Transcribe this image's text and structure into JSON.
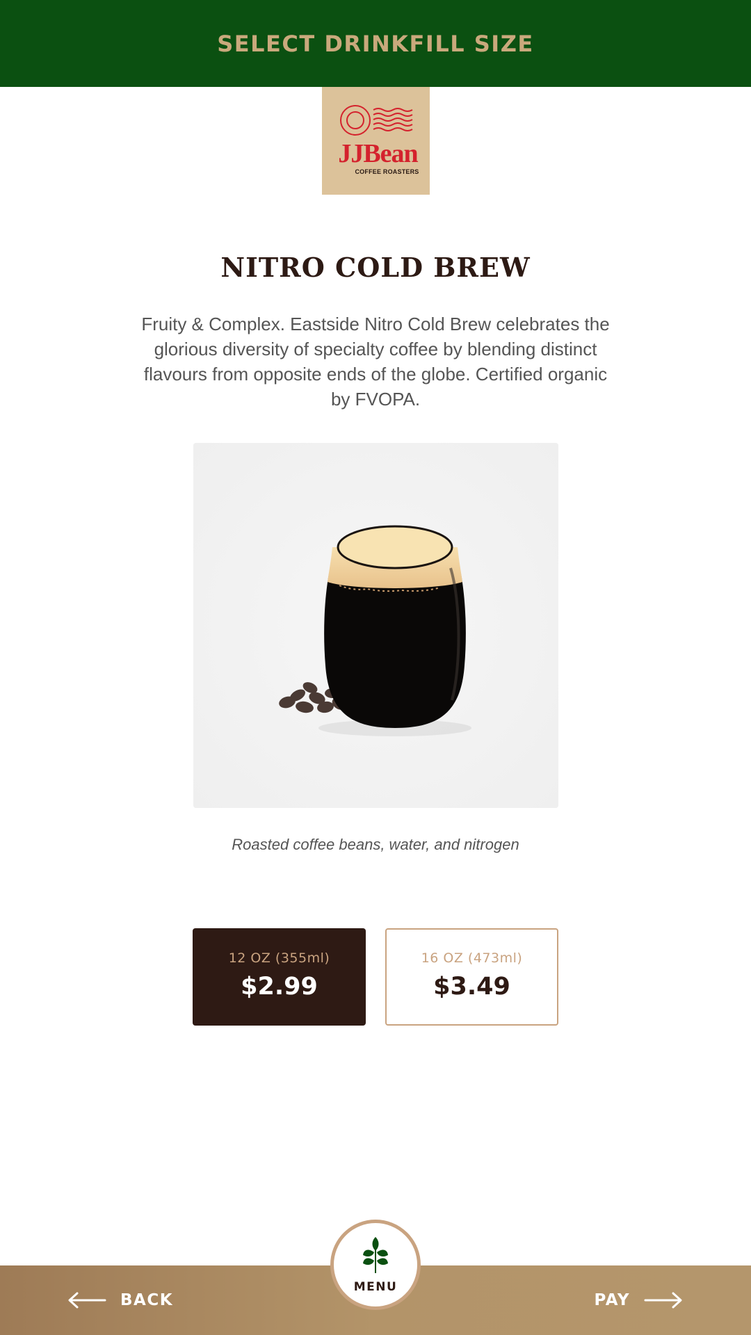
{
  "header": {
    "title": "SELECT DRINKFILL SIZE"
  },
  "logo": {
    "brand": "JJBean",
    "subtitle": "COFFEE ROASTERS"
  },
  "product": {
    "title": "NITRO COLD BREW",
    "description": "Fruity & Complex. Eastside Nitro Cold Brew celebrates the glorious diversity of specialty coffee by blending distinct flavours from opposite ends of the globe. Certified organic by FVOPA.",
    "ingredients": "Roasted coffee beans, water, and nitrogen"
  },
  "sizes": [
    {
      "label": "12 OZ (355ml)",
      "price": "$2.99",
      "selected": true
    },
    {
      "label": "16 OZ (473ml)",
      "price": "$3.49",
      "selected": false
    }
  ],
  "footer": {
    "back_label": "BACK",
    "menu_label": "MENU",
    "pay_label": "PAY"
  },
  "colors": {
    "header_bg": "#0b5011",
    "accent_tan": "#c9a380",
    "dark_brown": "#2e1a14",
    "logo_red": "#d4222d"
  },
  "icons": {
    "back": "arrow-left-icon",
    "pay": "arrow-right-icon",
    "menu": "leaf-icon",
    "logo_mark": "postmark-icon"
  }
}
